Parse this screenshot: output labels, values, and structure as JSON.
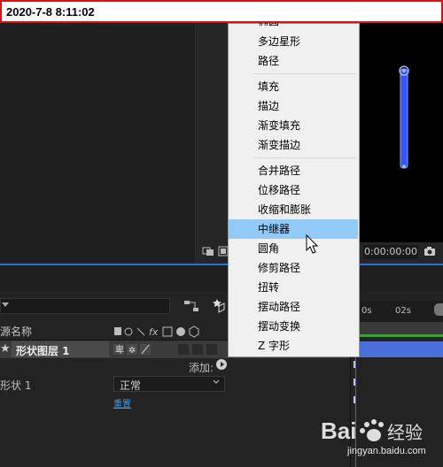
{
  "timestamp": "2020-7-8 8:11:02",
  "viewer": {
    "timecode": "0:00:00:00",
    "icons": [
      "snapshot-icon",
      "channel-toggle-icon",
      "camera-icon"
    ],
    "shape_color": "#3355ff"
  },
  "context_menu": {
    "top_partial": "椭圆",
    "groups": [
      [
        "多边星形",
        "路径"
      ],
      [
        "填充",
        "描边",
        "渐变填充",
        "渐变描边"
      ],
      [
        "合并路径",
        "位移路径",
        "收缩和膨胀",
        "中继器",
        "圆角",
        "修剪路径",
        "扭转",
        "摆动路径",
        "摆动变换",
        "Z 字形"
      ]
    ],
    "highlighted": "中继器",
    "highlight_color": "#91c9f7"
  },
  "timeline": {
    "columns": {
      "source_name": "源名称"
    },
    "switch_icons": [
      "shy-icon",
      "collapse-icon",
      "quality-icon",
      "fx-icon",
      "motion-blur-icon",
      "adjustment-icon",
      "3d-icon"
    ],
    "layer": {
      "name": "形状图层 1",
      "star": "★"
    },
    "add_label": "添加:",
    "shape_row": {
      "label": "形状 1",
      "blend_mode": "正常"
    },
    "reset_label": "重置",
    "ticks": [
      "0s",
      "02s"
    ],
    "keyframe_marker": "I",
    "layer_bar_color": "#4a6fd8",
    "playhead_color": "#2a6fd6"
  },
  "watermark": {
    "logo": "Baidu经验",
    "url": "jingyan.baidu.com"
  }
}
